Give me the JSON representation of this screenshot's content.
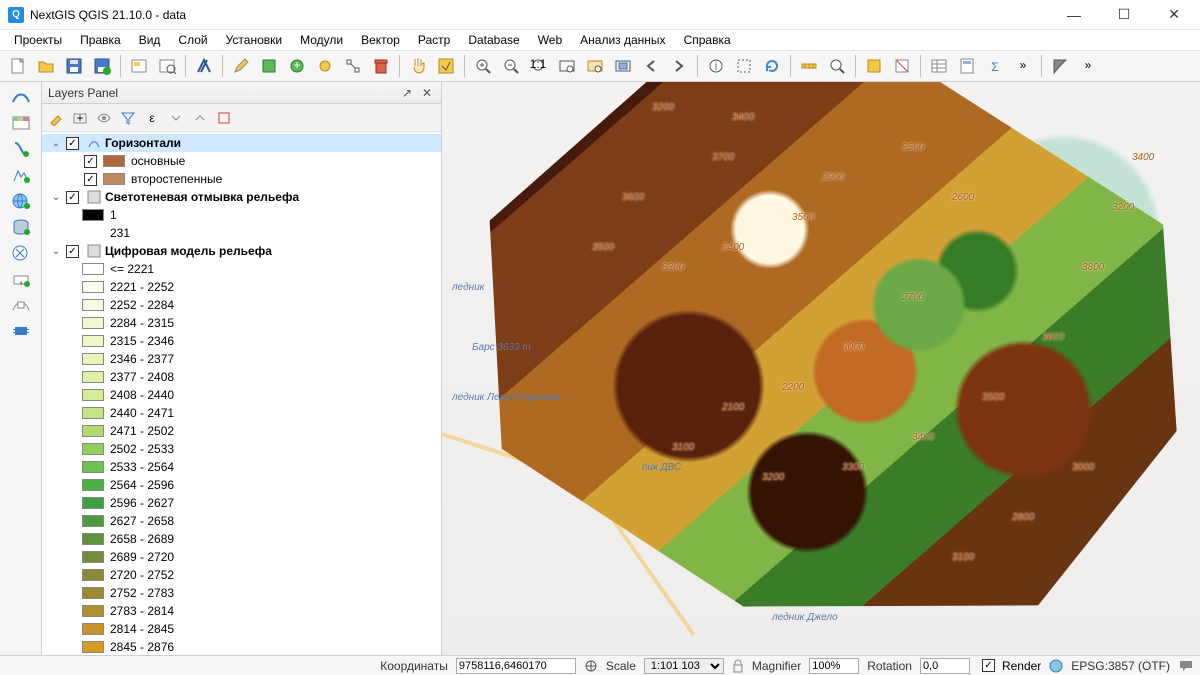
{
  "window": {
    "title": "NextGIS QGIS 21.10.0 - data",
    "app_glyph": "Q"
  },
  "menu": [
    "Проекты",
    "Правка",
    "Вид",
    "Слой",
    "Установки",
    "Модули",
    "Вектор",
    "Растр",
    "Database",
    "Web",
    "Анализ данных",
    "Справка"
  ],
  "win_buttons": {
    "min": "—",
    "max": "☐",
    "close": "✕"
  },
  "panel": {
    "title": "Layers Panel",
    "undock": "↗",
    "close": "✕"
  },
  "layers": {
    "contours": {
      "name": "Горизонтали",
      "sub": [
        {
          "name": "основные",
          "color": "#b06a3a"
        },
        {
          "name": "второстепенные",
          "color": "#c08a5a"
        }
      ]
    },
    "hillshade": {
      "name": "Светотеневая отмывка рельефа",
      "classes": [
        {
          "label": "1",
          "color": "#000000"
        },
        {
          "label": "231",
          "color": null
        }
      ]
    },
    "dem": {
      "name": "Цифровая модель рельефа",
      "classes": [
        {
          "label": "<= 2221",
          "color": "#ffffff"
        },
        {
          "label": "2221 - 2252",
          "color": "#fbfdee"
        },
        {
          "label": "2252 - 2284",
          "color": "#f6fbe0"
        },
        {
          "label": "2284 - 2315",
          "color": "#f1f9d2"
        },
        {
          "label": "2315 - 2346",
          "color": "#ecf7c4"
        },
        {
          "label": "2346 - 2377",
          "color": "#e7f5b6"
        },
        {
          "label": "2377 - 2408",
          "color": "#e0f2a6"
        },
        {
          "label": "2408 - 2440",
          "color": "#d4ec94"
        },
        {
          "label": "2440 - 2471",
          "color": "#c3e583"
        },
        {
          "label": "2471 - 2502",
          "color": "#aeda70"
        },
        {
          "label": "2502 - 2533",
          "color": "#8fcf5e"
        },
        {
          "label": "2533 - 2564",
          "color": "#6bc24e"
        },
        {
          "label": "2564 - 2596",
          "color": "#4ab344"
        },
        {
          "label": "2596 - 2627",
          "color": "#3aa23e"
        },
        {
          "label": "2627 - 2658",
          "color": "#4f9a3e"
        },
        {
          "label": "2658 - 2689",
          "color": "#5f923c"
        },
        {
          "label": "2689 - 2720",
          "color": "#748d3a"
        },
        {
          "label": "2720 - 2752",
          "color": "#888a36"
        },
        {
          "label": "2752 - 2783",
          "color": "#9a8a32"
        },
        {
          "label": "2783 - 2814",
          "color": "#b08f2e"
        },
        {
          "label": "2814 - 2845",
          "color": "#c6942a"
        },
        {
          "label": "2845 - 2876",
          "color": "#d89a26"
        }
      ]
    }
  },
  "status": {
    "coord_label": "Координаты",
    "coord_value": "9758116,6460170",
    "scale_label": "Scale",
    "scale_value": "1:101 103",
    "magnifier_label": "Magnifier",
    "magnifier_value": "100%",
    "rotation_label": "Rotation",
    "rotation_value": "0,0",
    "render_label": "Render",
    "crs": "EPSG:3857 (OTF)"
  },
  "map_labels": {
    "contours": [
      "3200",
      "3400",
      "3700",
      "3600",
      "3500",
      "3300",
      "3400",
      "3500",
      "2900",
      "2500",
      "2600",
      "2700",
      "3000",
      "2200",
      "2100",
      "3100",
      "3200",
      "3300",
      "3400",
      "3500",
      "3600",
      "3800",
      "3200",
      "3400",
      "3000",
      "2800",
      "3100"
    ],
    "glaciers": [
      "ледник Левый Карагем",
      "ледник Джело",
      "пик ДВС",
      "Барс 3633 m",
      "ледник"
    ]
  }
}
